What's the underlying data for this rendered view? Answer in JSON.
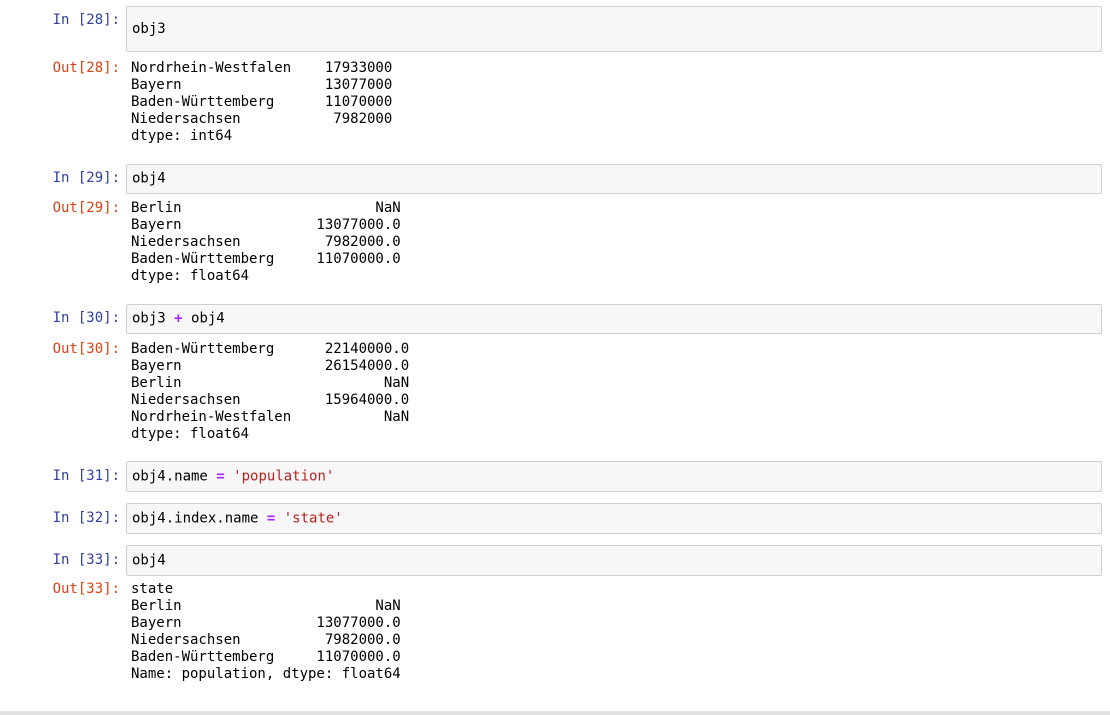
{
  "cells": [
    {
      "in_prompt": "In [28]:",
      "code": "obj3",
      "out_prompt": "Out[28]:",
      "output": "Nordrhein-Westfalen    17933000\nBayern                 13077000\nBaden-Württemberg      11070000\nNiedersachsen           7982000\ndtype: int64"
    },
    {
      "in_prompt": "In [29]:",
      "code": "obj4",
      "out_prompt": "Out[29]:",
      "output": "Berlin                       NaN\nBayern                13077000.0\nNiedersachsen          7982000.0\nBaden-Württemberg     11070000.0\ndtype: float64"
    },
    {
      "in_prompt": "In [30]:",
      "code_parts": [
        "obj3 ",
        "+",
        " obj4"
      ],
      "out_prompt": "Out[30]:",
      "output": "Baden-Württemberg      22140000.0\nBayern                 26154000.0\nBerlin                        NaN\nNiedersachsen          15964000.0\nNordrhein-Westfalen           NaN\ndtype: float64"
    },
    {
      "in_prompt": "In [31]:",
      "code_parts": [
        "obj4.name ",
        "=",
        " ",
        "'population'"
      ]
    },
    {
      "in_prompt": "In [32]:",
      "code_parts": [
        "obj4.index.name ",
        "=",
        " ",
        "'state'"
      ]
    },
    {
      "in_prompt": "In [33]:",
      "code": "obj4",
      "out_prompt": "Out[33]:",
      "output": "state\nBerlin                       NaN\nBayern                13077000.0\nNiedersachsen          7982000.0\nBaden-Württemberg     11070000.0\nName: population, dtype: float64"
    }
  ]
}
